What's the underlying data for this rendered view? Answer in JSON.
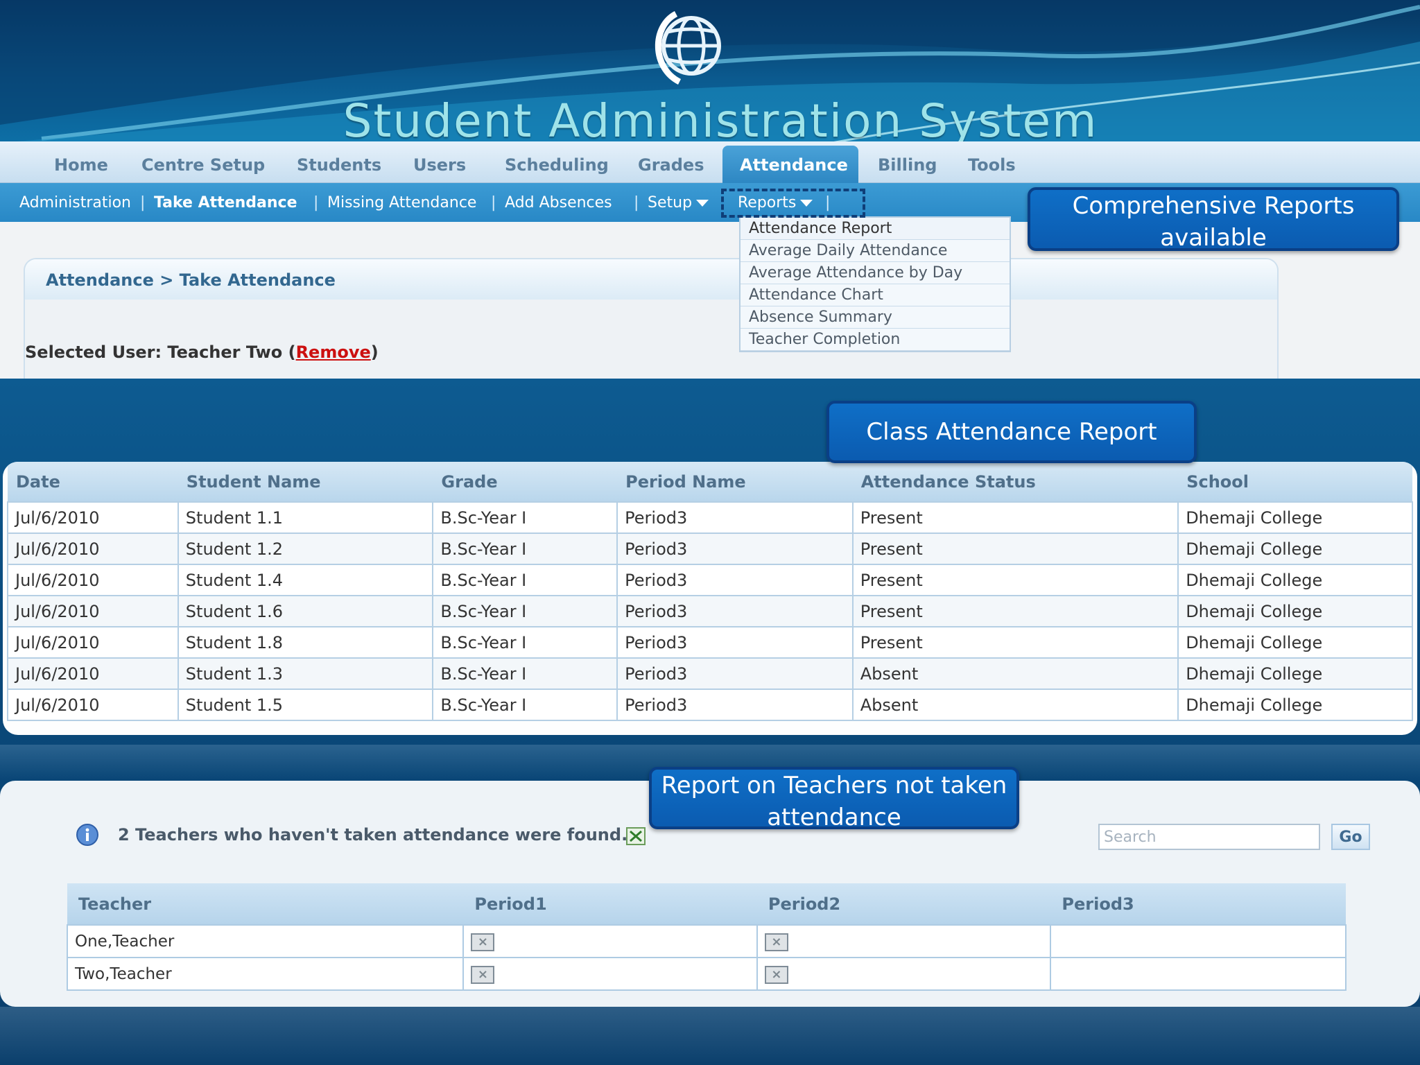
{
  "header": {
    "title": "Student Administration System",
    "logo_icon": "globe-logo-icon"
  },
  "main_nav": {
    "items": [
      "Home",
      "Centre Setup",
      "Students",
      "Users",
      "Scheduling",
      "Grades",
      "Attendance",
      "Billing",
      "Tools"
    ],
    "active": "Attendance"
  },
  "sub_nav": {
    "items": [
      "Administration",
      "Take Attendance",
      "Missing Attendance",
      "Add Absences",
      "Setup",
      "Reports"
    ],
    "separator": "|"
  },
  "reports_menu": {
    "items": [
      "Attendance Report",
      "Average Daily Attendance",
      "Average Attendance by Day",
      "Attendance Chart",
      "Absence Summary",
      "Teacher Completion"
    ]
  },
  "attendance_panel": {
    "breadcrumb": "Attendance > Take Attendance",
    "selected_user_label": "Selected User: Teacher Two (",
    "remove_link": "Remove",
    "selected_user_close": ")"
  },
  "callouts": {
    "reports": "Comprehensive Reports available",
    "class_report": "Class Attendance Report",
    "teachers_report": "Report on Teachers not taken attendance"
  },
  "class_table": {
    "columns": [
      "Date",
      "Student Name",
      "Grade",
      "Period Name",
      "Attendance Status",
      "School"
    ],
    "rows": [
      [
        "Jul/6/2010",
        "Student 1.1",
        "B.Sc-Year I",
        "Period3",
        "Present",
        "Dhemaji College"
      ],
      [
        "Jul/6/2010",
        "Student 1.2",
        "B.Sc-Year I",
        "Period3",
        "Present",
        "Dhemaji College"
      ],
      [
        "Jul/6/2010",
        "Student 1.4",
        "B.Sc-Year I",
        "Period3",
        "Present",
        "Dhemaji College"
      ],
      [
        "Jul/6/2010",
        "Student 1.6",
        "B.Sc-Year I",
        "Period3",
        "Present",
        "Dhemaji College"
      ],
      [
        "Jul/6/2010",
        "Student 1.8",
        "B.Sc-Year I",
        "Period3",
        "Present",
        "Dhemaji College"
      ],
      [
        "Jul/6/2010",
        "Student 1.3",
        "B.Sc-Year I",
        "Period3",
        "Absent",
        "Dhemaji College"
      ],
      [
        "Jul/6/2010",
        "Student 1.5",
        "B.Sc-Year I",
        "Period3",
        "Absent",
        "Dhemaji College"
      ]
    ]
  },
  "teachers_panel": {
    "message": "2 Teachers who haven't taken attendance were found.",
    "search_placeholder": "Search",
    "go_label": "Go",
    "columns": [
      "Teacher",
      "Period1",
      "Period2",
      "Period3"
    ],
    "rows": [
      {
        "teacher": "One,Teacher",
        "period1_missing": true,
        "period2_missing": true,
        "period3_missing": false
      },
      {
        "teacher": "Two,Teacher",
        "period1_missing": true,
        "period2_missing": true,
        "period3_missing": false
      }
    ],
    "missing_icon": "x-mark-icon"
  }
}
